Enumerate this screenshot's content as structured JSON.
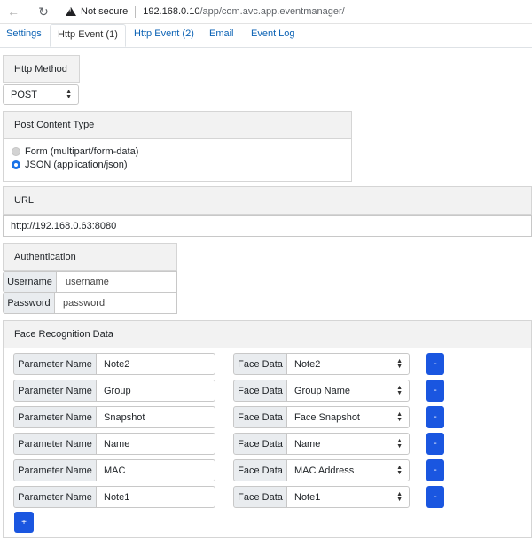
{
  "browser": {
    "not_secure": "Not secure",
    "url_host": "192.168.0.10",
    "url_path": "/app/com.avc.app.eventmanager/"
  },
  "tabs": [
    {
      "label": "Settings",
      "active": false
    },
    {
      "label": "Http Event (1)",
      "active": true
    },
    {
      "label": "Http Event (2)",
      "active": false
    },
    {
      "label": "Email",
      "active": false
    },
    {
      "label": "Event Log",
      "active": false
    }
  ],
  "http_method": {
    "title": "Http Method",
    "selected": "POST"
  },
  "post_content": {
    "title": "Post Content Type",
    "options": [
      {
        "label": "Form (multipart/form-data)",
        "checked": false
      },
      {
        "label": "JSON (application/json)",
        "checked": true
      }
    ]
  },
  "url": {
    "title": "URL",
    "value": "http://192.168.0.63:8080"
  },
  "auth": {
    "title": "Authentication",
    "username_label": "Username",
    "username_placeholder": "username",
    "password_label": "Password",
    "password_placeholder": "password"
  },
  "face": {
    "title": "Face Recognition Data",
    "param_label": "Parameter Name",
    "data_label": "Face Data",
    "del_label": "-",
    "add_label": "+",
    "rows": [
      {
        "param": "Note2",
        "data": "Note2"
      },
      {
        "param": "Group",
        "data": "Group Name"
      },
      {
        "param": "Snapshot",
        "data": "Face Snapshot"
      },
      {
        "param": "Name",
        "data": "Name"
      },
      {
        "param": "MAC",
        "data": "MAC Address"
      },
      {
        "param": "Note1",
        "data": "Note1"
      }
    ]
  }
}
